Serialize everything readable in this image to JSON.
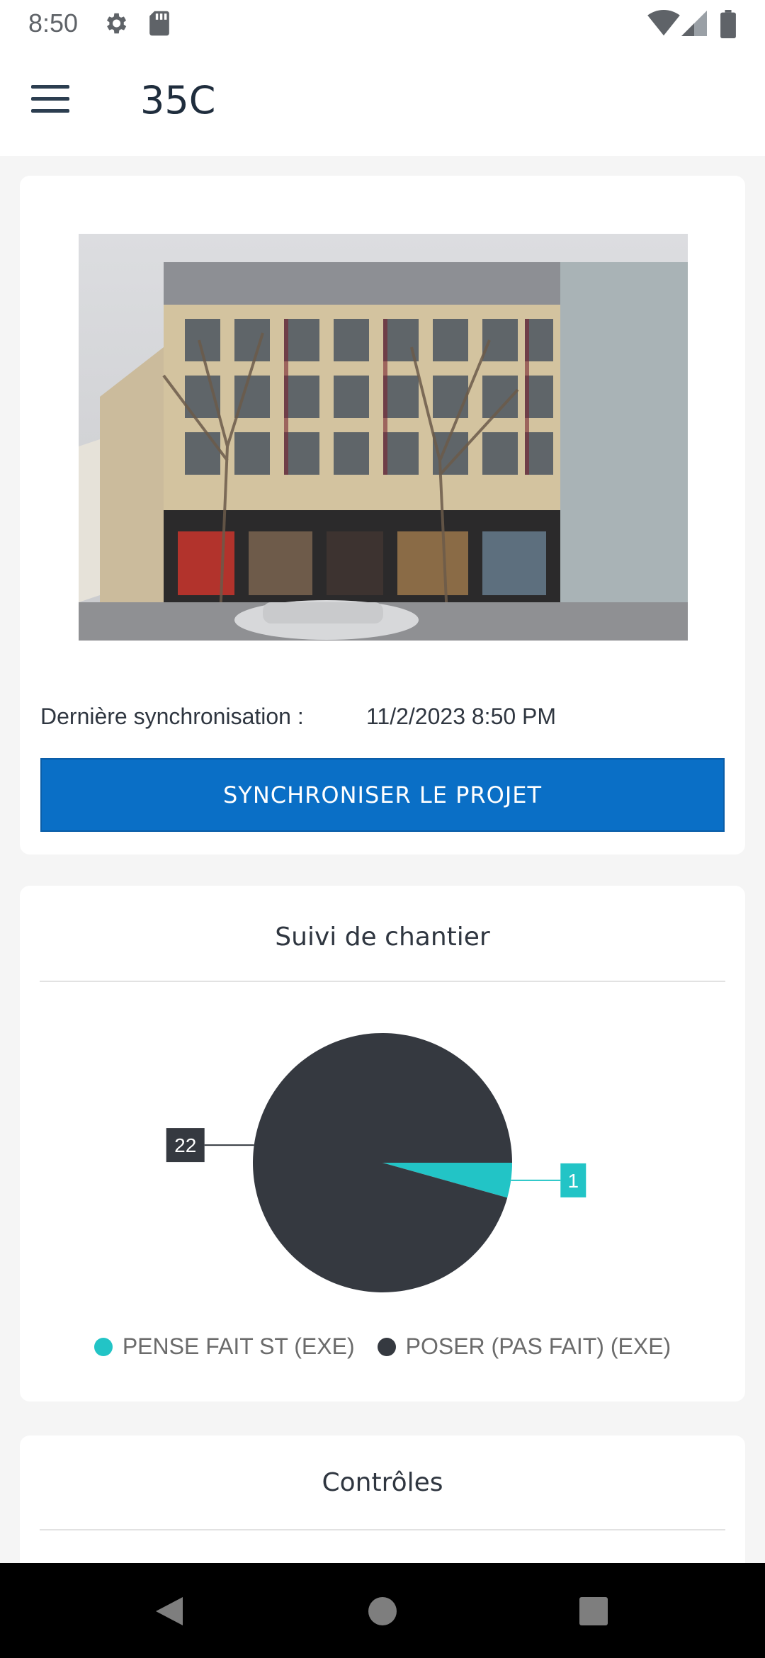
{
  "status_bar": {
    "time": "8:50",
    "icons": [
      "gear-icon",
      "sd-card-icon",
      "wifi-icon",
      "signal-icon",
      "battery-icon"
    ]
  },
  "app_bar": {
    "title": "35C",
    "menu_icon": "hamburger-menu-icon"
  },
  "project": {
    "sync_label": "Dernière synchronisation :",
    "sync_value": "11/2/2023 8:50 PM",
    "sync_button": "SYNCHRONISER LE PROJET"
  },
  "chart_section": {
    "title": "Suivi de chantier"
  },
  "chart_data": {
    "type": "pie",
    "slices": [
      {
        "label": "PENSE FAIT ST (EXE)",
        "value": 1,
        "color": "#22c4c6"
      },
      {
        "label": "POSER (PAS FAIT) (EXE)",
        "value": 22,
        "color": "#353940"
      }
    ],
    "title": "Suivi de chantier",
    "legend": "bottom"
  },
  "controls_section": {
    "title": "Contrôles"
  },
  "colors": {
    "accent": "#0a6fc6",
    "teal": "#22c4c6",
    "dark": "#353940"
  },
  "nav_bar": {
    "icons": [
      "back-icon",
      "home-icon",
      "recents-icon"
    ]
  }
}
